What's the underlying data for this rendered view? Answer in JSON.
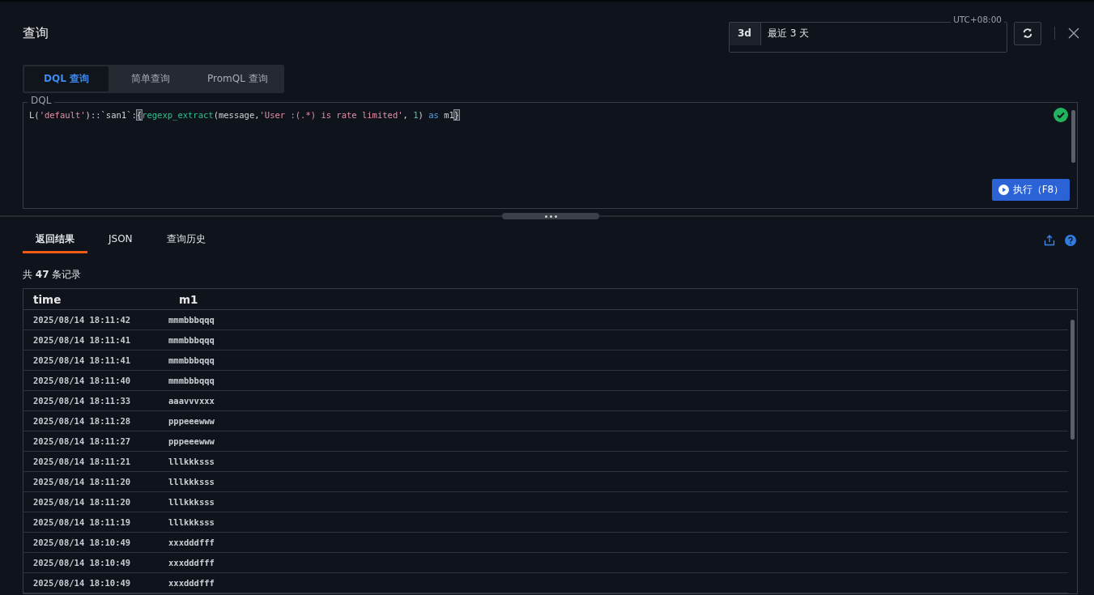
{
  "title": "查询",
  "time_range": {
    "shortcut": "3d",
    "label": "最近 3 天",
    "timezone": "UTC+08:00"
  },
  "query_tabs": [
    {
      "label": "DQL 查询",
      "selected": true
    },
    {
      "label": "简单查询",
      "selected": false
    },
    {
      "label": "PromQL 查询",
      "selected": false
    }
  ],
  "editor": {
    "legend": "DQL",
    "valid": true,
    "tokens": [
      {
        "text": "L(",
        "kind": "plain"
      },
      {
        "text": "'default'",
        "kind": "string"
      },
      {
        "text": ")::",
        "kind": "plain"
      },
      {
        "text": "`san1`",
        "kind": "plain"
      },
      {
        "text": ":",
        "kind": "plain"
      },
      {
        "text": "{",
        "kind": "bracket"
      },
      {
        "text": "regexp_extract",
        "kind": "func"
      },
      {
        "text": "(message,",
        "kind": "plain"
      },
      {
        "text": "'User :(.*) is rate limited'",
        "kind": "string"
      },
      {
        "text": ", ",
        "kind": "plain"
      },
      {
        "text": "1",
        "kind": "number"
      },
      {
        "text": ") ",
        "kind": "plain"
      },
      {
        "text": "as",
        "kind": "keyword"
      },
      {
        "text": " m1",
        "kind": "plain"
      },
      {
        "text": "}",
        "kind": "bracket"
      }
    ],
    "run_button": "执行（F8）"
  },
  "result_tabs": [
    {
      "label": "返回结果",
      "selected": true
    },
    {
      "label": "JSON",
      "selected": false
    },
    {
      "label": "查询历史",
      "selected": false
    }
  ],
  "record_count": "共 **47** 条记录",
  "table": {
    "columns": [
      "time",
      "m1"
    ],
    "rows": [
      [
        "2025/08/14 18:11:42",
        "mmmbbbqqq"
      ],
      [
        "2025/08/14 18:11:41",
        "mmmbbbqqq"
      ],
      [
        "2025/08/14 18:11:41",
        "mmmbbbqqq"
      ],
      [
        "2025/08/14 18:11:40",
        "mmmbbbqqq"
      ],
      [
        "2025/08/14 18:11:33",
        "aaavvvxxx"
      ],
      [
        "2025/08/14 18:11:28",
        "pppeeewww"
      ],
      [
        "2025/08/14 18:11:27",
        "pppeeewww"
      ],
      [
        "2025/08/14 18:11:21",
        "lllkkksss"
      ],
      [
        "2025/08/14 18:11:20",
        "lllkkksss"
      ],
      [
        "2025/08/14 18:11:20",
        "lllkkksss"
      ],
      [
        "2025/08/14 18:11:19",
        "lllkkksss"
      ],
      [
        "2025/08/14 18:10:49",
        "xxxdddfff"
      ],
      [
        "2025/08/14 18:10:49",
        "xxxdddfff"
      ],
      [
        "2025/08/14 18:10:49",
        "xxxdddfff"
      ]
    ]
  }
}
